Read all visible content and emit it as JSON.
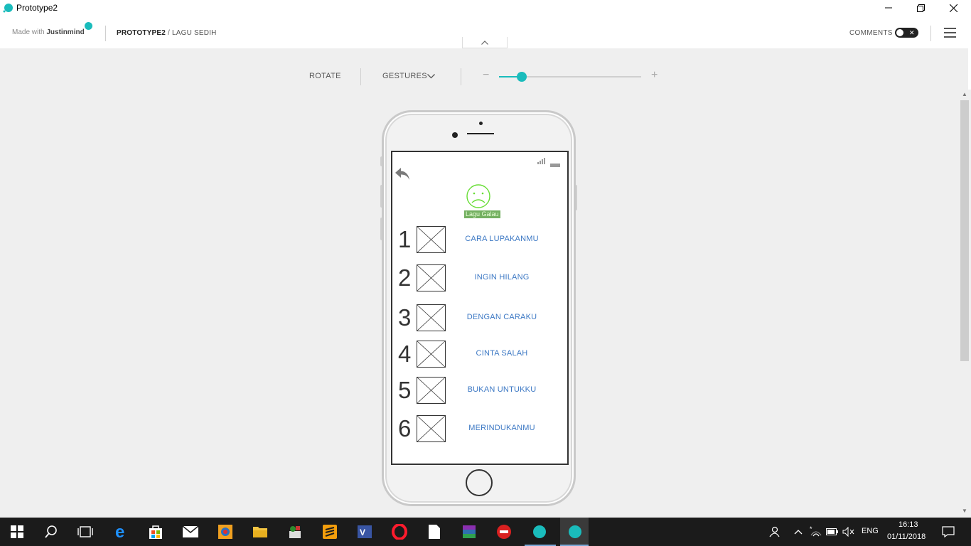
{
  "window": {
    "title": "Prototype2"
  },
  "toolbar": {
    "made_with": "Made with",
    "brand": "Justinmind",
    "breadcrumb_project": "PROTOTYPE2",
    "breadcrumb_sep": " / ",
    "breadcrumb_screen": "LAGU SEDIH",
    "comments_label": "COMMENTS",
    "comments_on": false
  },
  "controls": {
    "rotate_label": "ROTATE",
    "gestures_label": "GESTURES",
    "zoom_level": 0.16
  },
  "screen": {
    "title": "Lagu Galau",
    "songs": [
      {
        "num": "1",
        "title": "CARA LUPAKANMU"
      },
      {
        "num": "2",
        "title": "INGIN HILANG"
      },
      {
        "num": "3",
        "title": "DENGAN CARAKU"
      },
      {
        "num": "4",
        "title": "CINTA SALAH"
      },
      {
        "num": "5",
        "title": "BUKAN UNTUKKU"
      },
      {
        "num": "6",
        "title": "MERINDUKANMU"
      }
    ]
  },
  "taskbar": {
    "lang": "ENG",
    "time": "16:13",
    "date": "01/11/2018"
  },
  "colors": {
    "accent": "#1abcbc",
    "song_link": "#3c78c4",
    "sad_face": "#66dd33"
  }
}
